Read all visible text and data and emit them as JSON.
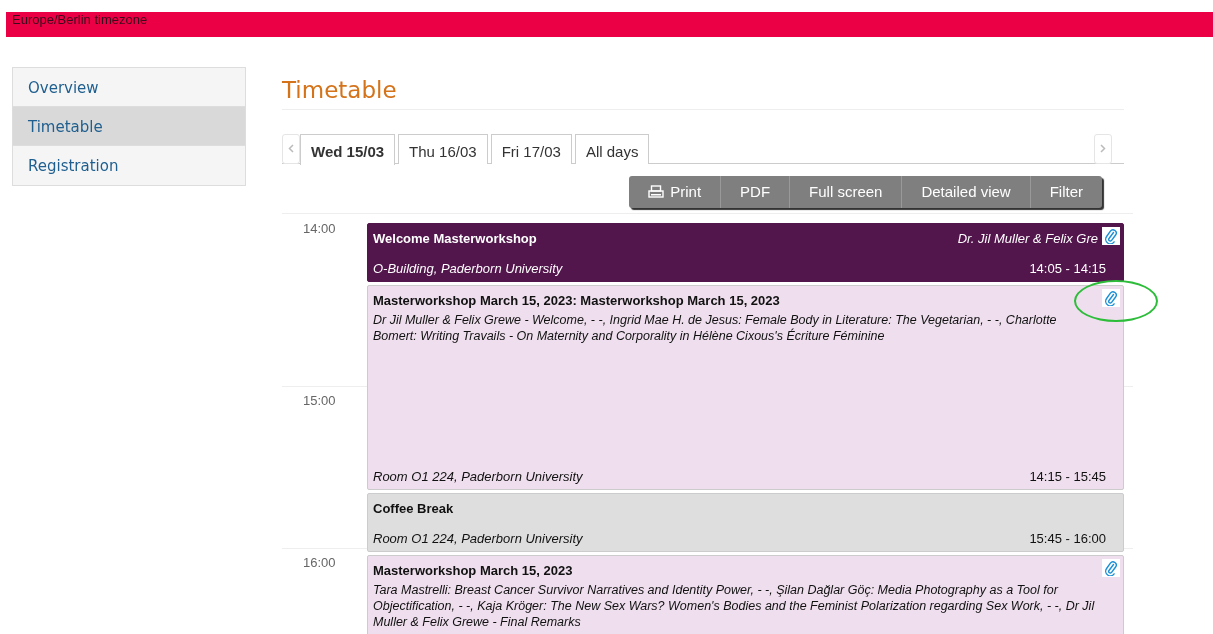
{
  "timezone": "Europe/Berlin timezone",
  "sidebar": {
    "items": [
      {
        "label": "Overview",
        "selected": false
      },
      {
        "label": "Timetable",
        "selected": true
      },
      {
        "label": "Registration",
        "selected": false
      }
    ]
  },
  "heading": "Timetable",
  "day_tabs": [
    {
      "label": "Wed 15/03",
      "selected": true
    },
    {
      "label": "Thu 16/03",
      "selected": false
    },
    {
      "label": "Fri 17/03",
      "selected": false
    },
    {
      "label": "All days",
      "selected": false
    }
  ],
  "toolbar": [
    {
      "label": "Print",
      "kind": "print"
    },
    {
      "label": "PDF",
      "kind": "text"
    },
    {
      "label": "Full screen",
      "kind": "text"
    },
    {
      "label": "Detailed view",
      "kind": "text"
    },
    {
      "label": "Filter",
      "kind": "text"
    }
  ],
  "hours": [
    "14:00",
    "15:00",
    "16:00"
  ],
  "entries": [
    {
      "kind": "header",
      "title": "Welcome Masterworkshop",
      "speakers": "Dr. Jil Muller & Felix Gre",
      "location": "O-Building, Paderborn University",
      "time": "14:05 - 14:15",
      "color": "#52154c",
      "attachment": true,
      "circled": false
    },
    {
      "kind": "contribution",
      "title": "Masterworkshop March 15, 2023: Masterworkshop March 15, 2023",
      "description": "Dr Jil Muller & Felix Grewe - Welcome, - -, Ingrid Mae H. de Jesus: Female Body in Literature: The Vegetarian, - -, Charlotte Bomert: Writing Travails - On Maternity and Corporality in Hélène Cixous's Écriture Féminine",
      "location": "Room O1 224, Paderborn University",
      "time": "14:15 - 15:45",
      "color": "#efdfee",
      "attachment": true,
      "circled": true
    },
    {
      "kind": "break",
      "title": "Coffee Break",
      "location": "Room O1 224, Paderborn University",
      "time": "15:45 - 16:00",
      "color": "#dedede",
      "attachment": false,
      "circled": false
    },
    {
      "kind": "contribution",
      "title": "Masterworkshop March 15, 2023",
      "description": "Tara Mastrelli: Breast Cancer Survivor Narratives and Identity Power, - -, Şilan Dağlar Göç: Media Photography as a Tool for Objectification, - -, Kaja Kröger: The New Sex Wars? Women's Bodies and the Feminist Polarization regarding Sex Work, - -, Dr Jil Muller & Felix Grewe - Final Remarks",
      "color": "#efdfee",
      "attachment": true,
      "circled": false
    }
  ]
}
